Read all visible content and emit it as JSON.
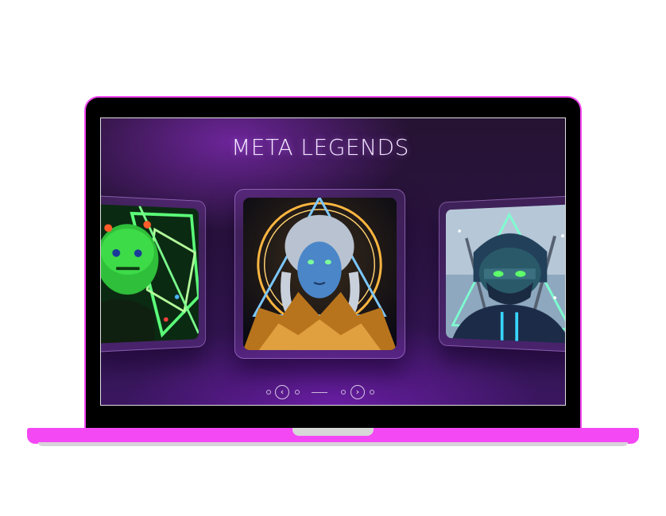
{
  "page": {
    "title": "META LEGENDS"
  },
  "colors": {
    "laptop_accent": "#f448f4",
    "screen_bg": "#2a1340",
    "title_text": "#f2e6ff"
  },
  "carousel": {
    "cards": [
      {
        "position": "left",
        "theme": "green-neon-character"
      },
      {
        "position": "center",
        "theme": "blue-chrome-character"
      },
      {
        "position": "right",
        "theme": "masked-ninja-character"
      }
    ],
    "controls": {
      "prev_icon": "chevron-left-icon",
      "next_icon": "chevron-right-icon",
      "prev_glyph": "‹",
      "next_glyph": "›"
    }
  }
}
